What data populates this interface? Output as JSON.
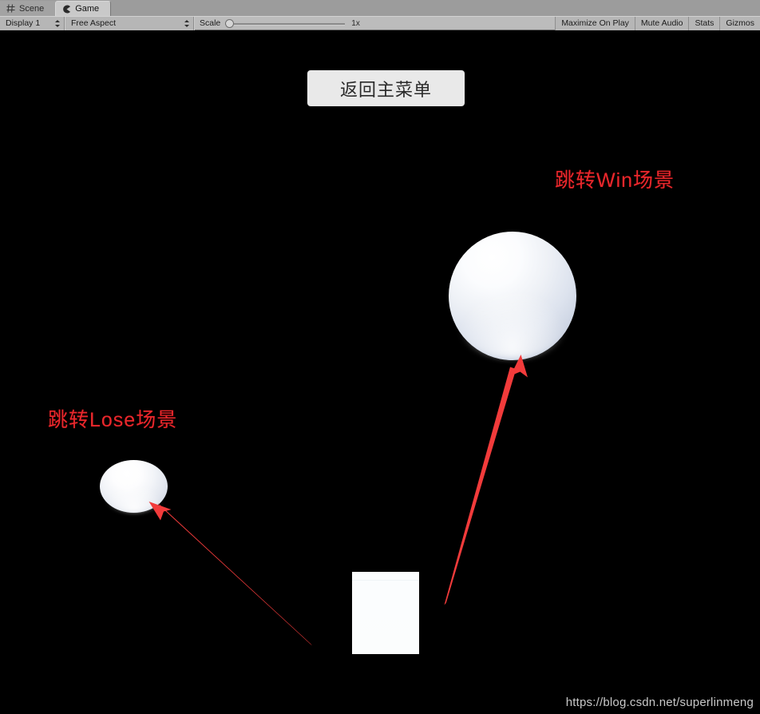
{
  "window": {
    "tabs": [
      {
        "label": "Scene",
        "icon": "grid-icon",
        "active": false
      },
      {
        "label": "Game",
        "icon": "game-pacman-icon",
        "active": true
      }
    ]
  },
  "toolbar": {
    "display_selector": {
      "label": "Display 1",
      "icon": "chevron-updown-icon"
    },
    "aspect_selector": {
      "label": "Free Aspect",
      "icon": "chevron-updown-icon"
    },
    "scale_label": "Scale",
    "scale_value": "1x",
    "scale_position_percent": 0,
    "maximize_on_play": "Maximize On Play",
    "mute_audio": "Mute Audio",
    "stats": "Stats",
    "gizmos": "Gizmos"
  },
  "game": {
    "background_color": "#000000",
    "menu_button": {
      "label": "返回主菜单",
      "background": "#e9e9e9",
      "text_color": "#2a2a2a"
    },
    "annotations": [
      {
        "id": "win",
        "text": "跳转Win场景",
        "color": "#e8282d"
      },
      {
        "id": "lose",
        "text": "跳转Lose场景",
        "color": "#e8282d"
      }
    ],
    "objects": [
      {
        "name": "sphere-large",
        "shape": "sphere",
        "color": "#ffffff"
      },
      {
        "name": "sphere-small",
        "shape": "squashed-sphere",
        "color": "#ffffff"
      },
      {
        "name": "cube",
        "shape": "cube",
        "color": "#fbfdfe"
      }
    ],
    "arrows": [
      {
        "name": "arrow-to-win-sphere",
        "color": "#f23b3b",
        "from": "tail-lower-left",
        "to": "sphere-large"
      },
      {
        "name": "arrow-to-lose-sphere",
        "color": "#f23b3b",
        "from": "tail-lower-right",
        "to": "sphere-small"
      }
    ]
  },
  "watermark": {
    "text": "https://blog.csdn.net/superlinmeng",
    "color": "#c8c8c8"
  }
}
